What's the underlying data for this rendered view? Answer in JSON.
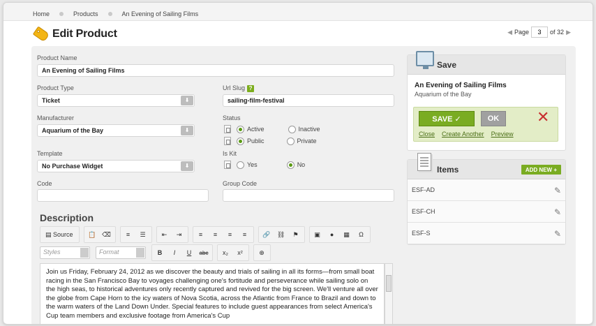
{
  "breadcrumb": [
    "Home",
    "Products",
    "An Evening of Sailing Films"
  ],
  "page": {
    "title": "Edit Product",
    "pager_label": "Page",
    "pager_value": "3",
    "pager_total": "of 32"
  },
  "form": {
    "product_name_label": "Product Name",
    "product_name": "An Evening of Sailing Films",
    "product_type_label": "Product Type",
    "product_type": "Ticket",
    "url_slug_label": "Url Slug",
    "url_slug_help": "?",
    "url_slug": "sailing-film-festival",
    "manufacturer_label": "Manufacturer",
    "manufacturer": "Aquarium of the Bay",
    "status_label": "Status",
    "status_active": "Active",
    "status_inactive": "Inactive",
    "status_public": "Public",
    "status_private": "Private",
    "template_label": "Template",
    "template": "No Purchase Widget",
    "is_kit_label": "Is Kit",
    "is_kit_yes": "Yes",
    "is_kit_no": "No",
    "code_label": "Code",
    "code": "",
    "group_code_label": "Group Code",
    "group_code": ""
  },
  "description": {
    "title": "Description",
    "source_label": "Source",
    "styles_placeholder": "Styles",
    "format_placeholder": "Format",
    "text": "Join us Friday, February 24, 2012 as we discover the beauty and trials of sailing in all its forms—from small boat racing in the San Francisco Bay to voyages challenging one's fortitude and perseverance while sailing solo on the high seas, to historical adventures only recently captured and revived for the big screen. We'll venture all over the globe from Cape Horn to the icy waters of Nova Scotia, across the Atlantic from France to Brazil and down to the warm waters of the Land Down Under. Special features to include guest appearances from select America's Cup team members and exclusive footage from America's Cup"
  },
  "save_panel": {
    "title": "Save",
    "product_name": "An Evening of Sailing Films",
    "manufacturer": "Aquarium of the Bay",
    "save_label": "SAVE ✓",
    "ok_label": "OK",
    "close_label": "Close",
    "create_another_label": "Create Another",
    "preview_label": "Preview"
  },
  "items_panel": {
    "title": "Items",
    "add_new_label": "ADD NEW +",
    "items": [
      "ESF-AD",
      "ESF-CH",
      "ESF-S"
    ]
  },
  "colors": {
    "accent_green": "#7aac22",
    "close_red": "#c83030"
  }
}
